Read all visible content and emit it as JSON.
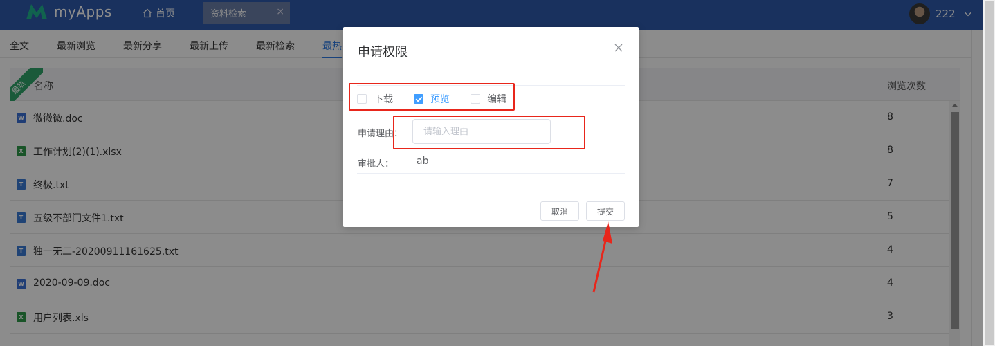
{
  "app": {
    "logo_text": "myApps"
  },
  "header": {
    "home_label": "首页",
    "open_tab_label": "资料检索",
    "open_tab_close": "×",
    "user_name": "222"
  },
  "subtabs": [
    "全文",
    "最新浏览",
    "最新分享",
    "最新上传",
    "最新检索",
    "最热"
  ],
  "table": {
    "ribbon_label": "最热",
    "headers": {
      "name": "名称",
      "views": "浏览次数"
    },
    "rows": [
      {
        "type": "W",
        "name": "微微微.doc",
        "views": "8"
      },
      {
        "type": "X",
        "name": "工作计划(2)(1).xlsx",
        "views": "8"
      },
      {
        "type": "T",
        "name": "终极.txt",
        "views": "7"
      },
      {
        "type": "T",
        "name": "五级不部门文件1.txt",
        "views": "5"
      },
      {
        "type": "T",
        "name": "独一无二-20200911161625.txt",
        "views": "4"
      },
      {
        "type": "W",
        "name": "2020-09-09.doc",
        "views": "4"
      },
      {
        "type": "X",
        "name": "用户列表.xls",
        "views": "3"
      }
    ]
  },
  "dialog": {
    "title": "申请权限",
    "permissions": [
      {
        "label": "下载",
        "checked": false
      },
      {
        "label": "预览",
        "checked": true
      },
      {
        "label": "编辑",
        "checked": false
      }
    ],
    "reason_label": "申请理由：",
    "reason_placeholder": "请输入理由",
    "reason_value": "",
    "approver_label": "审批人：",
    "approver_value": "ab",
    "cancel_label": "取消",
    "submit_label": "提交"
  },
  "colors": {
    "header_bg": "#2e5aab",
    "accent": "#409eff",
    "annotation": "#e8261b",
    "ribbon": "#31a56a"
  }
}
